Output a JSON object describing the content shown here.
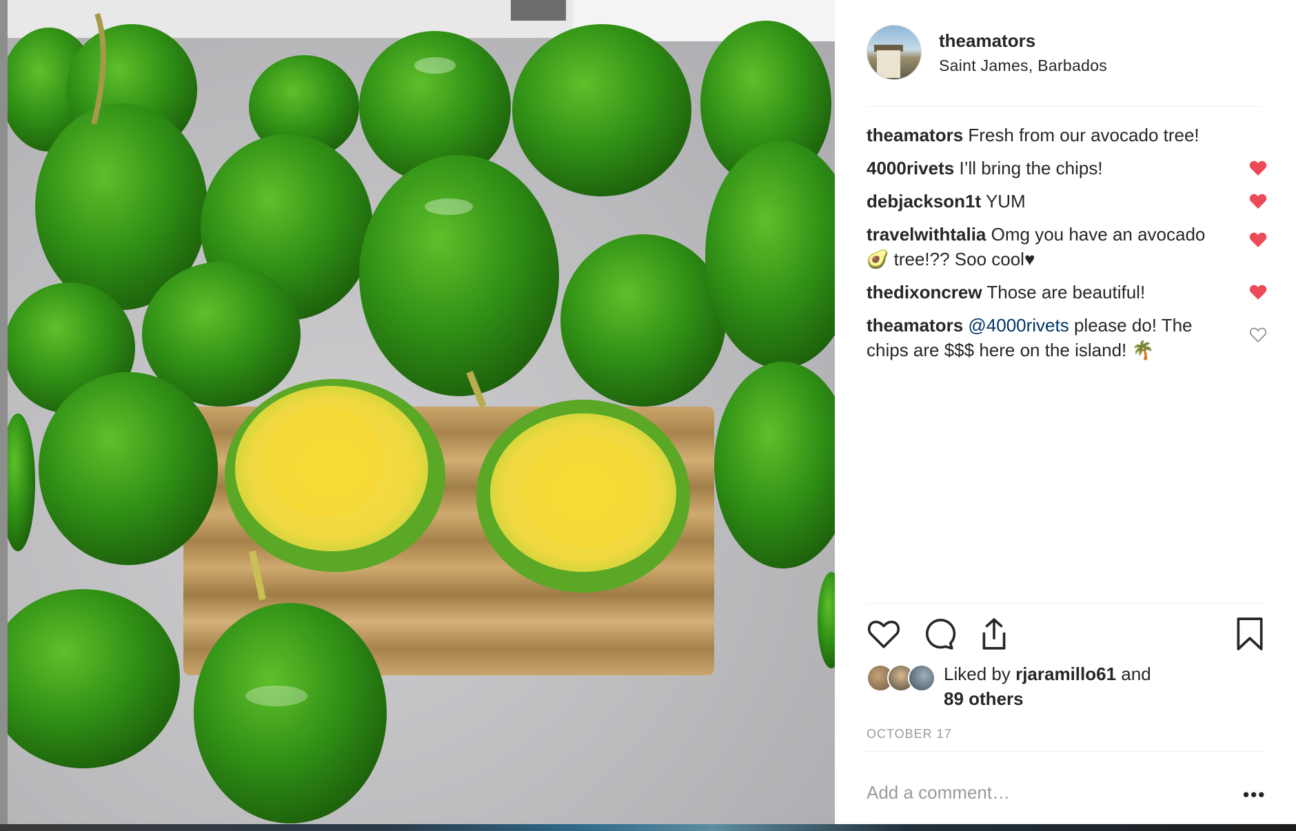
{
  "post": {
    "username": "theamators",
    "location": "Saint James, Barbados",
    "date": "OCTOBER 17"
  },
  "comments": [
    {
      "user": "theamators",
      "text": "Fresh from our avocado tree!",
      "liked": null
    },
    {
      "user": "4000rivets",
      "text": "I’ll bring the chips!",
      "liked": true
    },
    {
      "user": "debjackson1t",
      "text": "YUM",
      "liked": true
    },
    {
      "user": "travelwithtalia",
      "text": "Omg you have an avocado 🥑  tree!?? Soo cool♥",
      "liked": true
    },
    {
      "user": "thedixoncrew",
      "text": "Those are beautiful!",
      "liked": true
    },
    {
      "user": "theamators",
      "mention": "@4000rivets",
      "text": " please do! The chips are $$$ here on the island! 🌴",
      "liked": false
    }
  ],
  "likes": {
    "prefix": "Liked by ",
    "user": "rjaramillo61",
    "middle": " and",
    "others": "89 others"
  },
  "comment_box": {
    "placeholder": "Add a comment…",
    "more": "•••"
  },
  "colors": {
    "heart_red": "#ed4956",
    "mention_blue": "#003569",
    "muted_gray": "#999999"
  },
  "icons": [
    "heart-icon",
    "comment-icon",
    "share-icon",
    "bookmark-icon",
    "more-options-icon"
  ]
}
